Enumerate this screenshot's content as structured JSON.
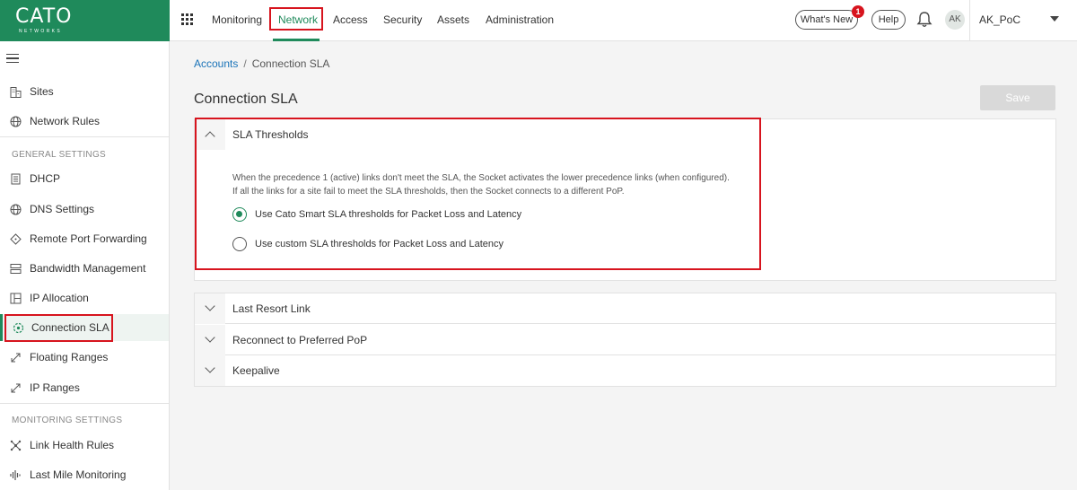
{
  "brand": {
    "name": "CATO",
    "tagline": "NETWORKS",
    "accent": "#1f8a5b"
  },
  "topnav": {
    "items": [
      "Monitoring",
      "Network",
      "Access",
      "Security",
      "Assets",
      "Administration"
    ],
    "active": "Network",
    "whats_new": "What's New",
    "whats_new_count": "1",
    "help": "Help",
    "avatar": "AK",
    "account": "AK_PoC"
  },
  "sidebar": {
    "items": [
      {
        "label": "Sites",
        "icon": "building-icon"
      },
      {
        "label": "Network Rules",
        "icon": "globe-icon"
      }
    ],
    "general_title": "GENERAL SETTINGS",
    "general": [
      {
        "label": "DHCP",
        "icon": "document-icon"
      },
      {
        "label": "DNS Settings",
        "icon": "globe-icon"
      },
      {
        "label": "Remote Port Forwarding",
        "icon": "diamond-icon"
      },
      {
        "label": "Bandwidth Management",
        "icon": "bandwidth-icon"
      },
      {
        "label": "IP Allocation",
        "icon": "grid-icon"
      },
      {
        "label": "Connection SLA",
        "icon": "sla-icon"
      },
      {
        "label": "Floating Ranges",
        "icon": "expand-icon"
      },
      {
        "label": "IP Ranges",
        "icon": "expand-icon"
      }
    ],
    "monitoring_title": "MONITORING SETTINGS",
    "monitoring": [
      {
        "label": "Link Health Rules",
        "icon": "health-icon"
      },
      {
        "label": "Last Mile Monitoring",
        "icon": "pulse-icon"
      }
    ],
    "active": "Connection SLA"
  },
  "breadcrumb": {
    "root": "Accounts",
    "separator": "/",
    "current": "Connection SLA"
  },
  "page": {
    "title": "Connection SLA",
    "save": "Save"
  },
  "sla_panel": {
    "title": "SLA Thresholds",
    "desc_line1": "When the precedence 1 (active) links don't meet the SLA, the Socket activates the lower precedence links (when configured).",
    "desc_line2": "If all the links for a site fail to meet the SLA thresholds, then the Socket connects to a different PoP.",
    "option1": "Use Cato Smart SLA thresholds for Packet Loss and Latency",
    "option2": "Use custom SLA thresholds for Packet Loss and Latency",
    "selected": "option1"
  },
  "accordions": [
    "Last Resort Link",
    "Reconnect to Preferred PoP",
    "Keepalive"
  ]
}
